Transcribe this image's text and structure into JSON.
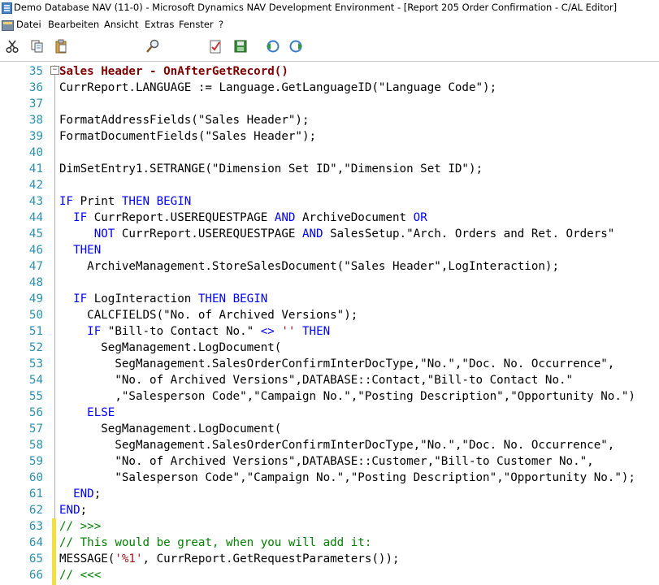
{
  "window": {
    "title": "Demo Database NAV (11-0) - Microsoft Dynamics NAV Development Environment - [Report 205 Order Confirmation - C/AL Editor]"
  },
  "menu": {
    "items": [
      "Datei",
      "Bearbeiten",
      "Ansicht",
      "Extras",
      "Fenster",
      "?"
    ]
  },
  "toolbar": {
    "icons": [
      "cut-icon",
      "copy-icon",
      "paste-icon",
      "find-icon",
      "compile-icon",
      "save-icon",
      "prev-icon",
      "next-icon"
    ]
  },
  "editor": {
    "lines": [
      {
        "num": "35",
        "segs": [
          {
            "t": "Sales Header - OnAfterGetRecord()",
            "c": "fn"
          }
        ]
      },
      {
        "num": "36",
        "segs": [
          {
            "t": "CurrReport.LANGUAGE := Language.GetLanguageID(\"Language Code\");",
            "c": ""
          }
        ]
      },
      {
        "num": "37",
        "segs": []
      },
      {
        "num": "38",
        "segs": [
          {
            "t": "FormatAddressFields(\"Sales Header\");",
            "c": ""
          }
        ]
      },
      {
        "num": "39",
        "segs": [
          {
            "t": "FormatDocumentFields(\"Sales Header\");",
            "c": ""
          }
        ]
      },
      {
        "num": "40",
        "segs": []
      },
      {
        "num": "41",
        "segs": [
          {
            "t": "DimSetEntry1.SETRANGE(\"Dimension Set ID\",\"Dimension Set ID\");",
            "c": ""
          }
        ]
      },
      {
        "num": "42",
        "segs": []
      },
      {
        "num": "43",
        "segs": [
          {
            "t": "IF",
            "c": "kw"
          },
          {
            "t": " Print ",
            "c": ""
          },
          {
            "t": "THEN BEGIN",
            "c": "kw"
          }
        ]
      },
      {
        "num": "44",
        "segs": [
          {
            "t": "  ",
            "c": ""
          },
          {
            "t": "IF",
            "c": "kw"
          },
          {
            "t": " CurrReport.USEREQUESTPAGE ",
            "c": ""
          },
          {
            "t": "AND",
            "c": "kw"
          },
          {
            "t": " ArchiveDocument ",
            "c": ""
          },
          {
            "t": "OR",
            "c": "kw"
          }
        ]
      },
      {
        "num": "45",
        "segs": [
          {
            "t": "     ",
            "c": ""
          },
          {
            "t": "NOT",
            "c": "kw"
          },
          {
            "t": " CurrReport.USEREQUESTPAGE ",
            "c": ""
          },
          {
            "t": "AND",
            "c": "kw"
          },
          {
            "t": " SalesSetup.\"Arch. Orders and Ret. Orders\"",
            "c": ""
          }
        ]
      },
      {
        "num": "46",
        "segs": [
          {
            "t": "  ",
            "c": ""
          },
          {
            "t": "THEN",
            "c": "kw"
          }
        ]
      },
      {
        "num": "47",
        "segs": [
          {
            "t": "    ArchiveManagement.StoreSalesDocument(\"Sales Header\",LogInteraction);",
            "c": ""
          }
        ]
      },
      {
        "num": "48",
        "segs": []
      },
      {
        "num": "49",
        "segs": [
          {
            "t": "  ",
            "c": ""
          },
          {
            "t": "IF",
            "c": "kw"
          },
          {
            "t": " LogInteraction ",
            "c": ""
          },
          {
            "t": "THEN BEGIN",
            "c": "kw"
          }
        ]
      },
      {
        "num": "50",
        "segs": [
          {
            "t": "    CALCFIELDS(\"No. of Archived Versions\");",
            "c": ""
          }
        ]
      },
      {
        "num": "51",
        "segs": [
          {
            "t": "    ",
            "c": ""
          },
          {
            "t": "IF",
            "c": "kw"
          },
          {
            "t": " \"Bill-to Contact No.\" ",
            "c": ""
          },
          {
            "t": "<>",
            "c": "kw"
          },
          {
            "t": " ",
            "c": ""
          },
          {
            "t": "''",
            "c": "st"
          },
          {
            "t": " ",
            "c": ""
          },
          {
            "t": "THEN",
            "c": "kw"
          }
        ]
      },
      {
        "num": "52",
        "segs": [
          {
            "t": "      SegManagement.LogDocument(",
            "c": ""
          }
        ]
      },
      {
        "num": "53",
        "segs": [
          {
            "t": "        SegManagement.SalesOrderConfirmInterDocType,\"No.\",\"Doc. No. Occurrence\",",
            "c": ""
          }
        ]
      },
      {
        "num": "54",
        "segs": [
          {
            "t": "        \"No. of Archived Versions\",DATABASE::Contact,\"Bill-to Contact No.\"",
            "c": ""
          }
        ]
      },
      {
        "num": "55",
        "segs": [
          {
            "t": "        ,\"Salesperson Code\",\"Campaign No.\",\"Posting Description\",\"Opportunity No.\")",
            "c": ""
          }
        ]
      },
      {
        "num": "56",
        "segs": [
          {
            "t": "    ",
            "c": ""
          },
          {
            "t": "ELSE",
            "c": "kw"
          }
        ]
      },
      {
        "num": "57",
        "segs": [
          {
            "t": "      SegManagement.LogDocument(",
            "c": ""
          }
        ]
      },
      {
        "num": "58",
        "segs": [
          {
            "t": "        SegManagement.SalesOrderConfirmInterDocType,\"No.\",\"Doc. No. Occurrence\",",
            "c": ""
          }
        ]
      },
      {
        "num": "59",
        "segs": [
          {
            "t": "        \"No. of Archived Versions\",DATABASE::Customer,\"Bill-to Customer No.\",",
            "c": ""
          }
        ]
      },
      {
        "num": "60",
        "segs": [
          {
            "t": "        \"Salesperson Code\",\"Campaign No.\",\"Posting Description\",\"Opportunity No.\");",
            "c": ""
          }
        ]
      },
      {
        "num": "61",
        "segs": [
          {
            "t": "  ",
            "c": ""
          },
          {
            "t": "END",
            "c": "kw"
          },
          {
            "t": ";",
            "c": ""
          }
        ]
      },
      {
        "num": "62",
        "segs": [
          {
            "t": "END",
            "c": "kw"
          },
          {
            "t": ";",
            "c": ""
          }
        ]
      },
      {
        "num": "63",
        "segs": [
          {
            "t": "// >>>",
            "c": "cm"
          }
        ]
      },
      {
        "num": "64",
        "segs": [
          {
            "t": "// This would be great, when you will add it:",
            "c": "cm"
          }
        ]
      },
      {
        "num": "65",
        "segs": [
          {
            "t": "MESSAGE(",
            "c": ""
          },
          {
            "t": "'%1'",
            "c": "st"
          },
          {
            "t": ", CurrReport.GetRequestParameters());",
            "c": ""
          }
        ]
      },
      {
        "num": "66",
        "segs": [
          {
            "t": "// <<<",
            "c": "cm"
          }
        ]
      }
    ]
  }
}
